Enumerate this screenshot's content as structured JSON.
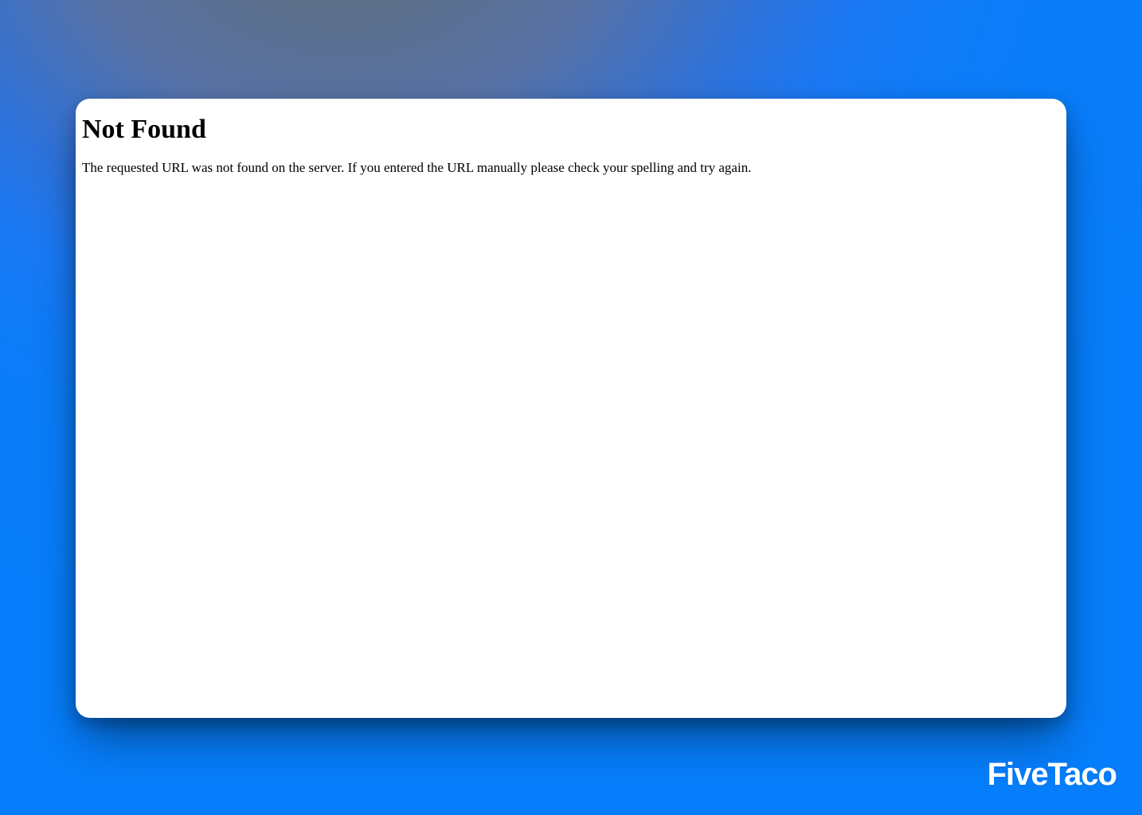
{
  "error": {
    "heading": "Not Found",
    "message": "The requested URL was not found on the server. If you entered the URL manually please check your spelling and try again."
  },
  "brand": {
    "name": "FiveTaco"
  }
}
